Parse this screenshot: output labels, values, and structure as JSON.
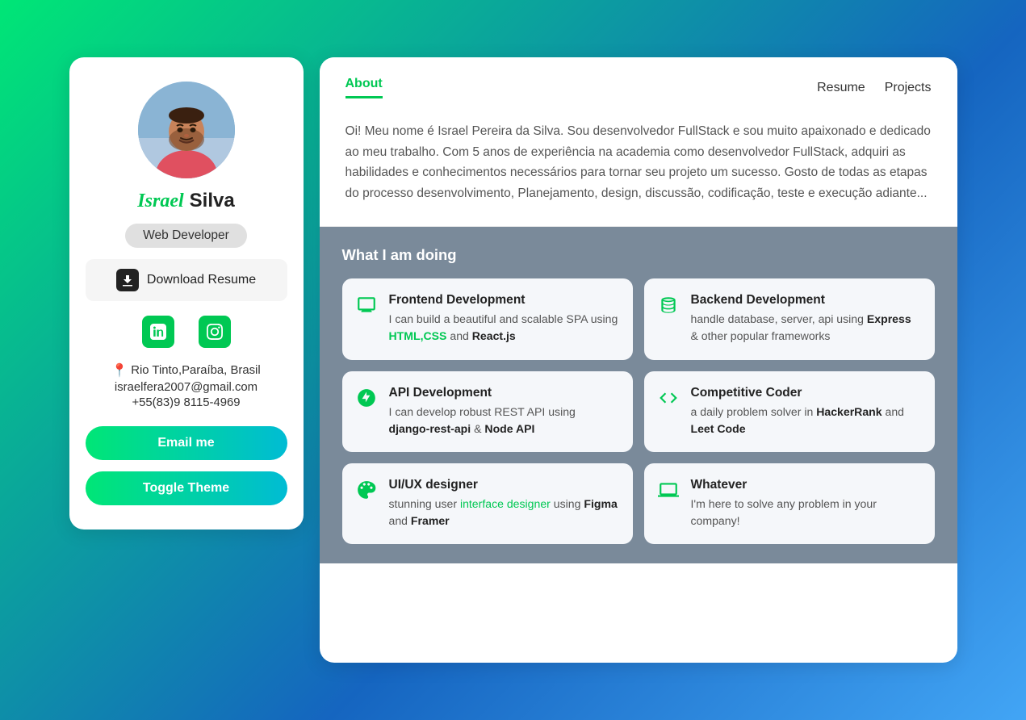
{
  "leftCard": {
    "name": {
      "first": "Israel",
      "last": "Silva"
    },
    "role": "Web Developer",
    "downloadBtn": "Download Resume",
    "social": {
      "linkedin": "in",
      "instagram": "◎"
    },
    "location": "Rio Tinto,Paraíba, Brasil",
    "email": "israelfera2007@gmail.com",
    "phone": "+55(83)9 8115-4969",
    "emailBtn": "Email me",
    "toggleBtn": "Toggle Theme"
  },
  "rightCard": {
    "tabs": {
      "active": "About",
      "items": [
        "About",
        "Resume",
        "Projects"
      ]
    },
    "aboutText": "Oi! Meu nome é Israel Pereira da Silva. Sou desenvolvedor FullStack e sou muito apaixonado e dedicado ao meu trabalho. Com 5 anos de experiência na academia como desenvolvedor FullStack, adquiri as habilidades e conhecimentos necessários para tornar seu projeto um sucesso. Gosto de todas as etapas do processo desenvolvimento, Planejamento, design, discussão, codificação, teste e execução adiante...",
    "whatTitle": "What I am doing",
    "services": [
      {
        "title": "Frontend Development",
        "desc": "I can build a beautiful and scalable SPA using HTML,CSS and React.js",
        "icon": "monitor"
      },
      {
        "title": "Backend Development",
        "desc": "handle database, server, api using Express & other popular frameworks",
        "icon": "database"
      },
      {
        "title": "API Development",
        "desc": "I can develop robust REST API using django-rest-api & Node API",
        "icon": "api"
      },
      {
        "title": "Competitive Coder",
        "desc": "a daily problem solver in HackerRank and Leet Code",
        "icon": "code"
      },
      {
        "title": "UI/UX designer",
        "desc": "stunning user interface designer using Figma and Framer",
        "icon": "design"
      },
      {
        "title": "Whatever",
        "desc": "I'm here to solve any problem in your company!",
        "icon": "laptop"
      }
    ]
  }
}
